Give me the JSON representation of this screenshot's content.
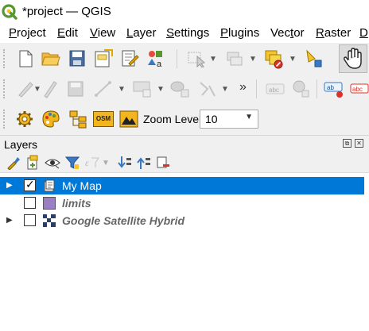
{
  "window": {
    "title": "*project — QGIS"
  },
  "menu": [
    {
      "label": "Project",
      "mnemonic_index": 0
    },
    {
      "label": "Edit",
      "mnemonic_index": 0
    },
    {
      "label": "View",
      "mnemonic_index": 0
    },
    {
      "label": "Layer",
      "mnemonic_index": 0
    },
    {
      "label": "Settings",
      "mnemonic_index": 0
    },
    {
      "label": "Plugins",
      "mnemonic_index": 0
    },
    {
      "label": "Vector",
      "mnemonic_index": 3
    },
    {
      "label": "Raster",
      "mnemonic_index": 0
    },
    {
      "label": "D",
      "mnemonic_index": 0
    }
  ],
  "toolbar3": {
    "osm_label": "OSM",
    "zoom_label": "Zoom Level:",
    "zoom_value": "10"
  },
  "panel": {
    "title": "Layers"
  },
  "layers": [
    {
      "name": "My Map",
      "checked": true,
      "selected": true,
      "expandable": true,
      "italic": false,
      "icon": "layer-group-icon"
    },
    {
      "name": "limits",
      "checked": false,
      "selected": false,
      "expandable": false,
      "italic": true,
      "icon": "polygon-symbol-icon",
      "symbol_color": "#9b7fc4"
    },
    {
      "name": "Google Satellite Hybrid",
      "checked": false,
      "selected": false,
      "expandable": true,
      "italic": true,
      "icon": "raster-layer-icon"
    }
  ],
  "colors": {
    "selection": "#0078d7",
    "toolbar_bg": "#f0f0f0",
    "qgis_green": "#589632"
  }
}
